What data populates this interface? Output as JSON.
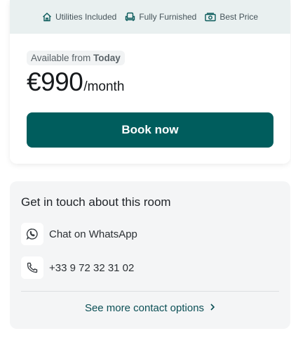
{
  "features": {
    "utilities": "Utilities Included",
    "furnished": "Fully Furnished",
    "price": "Best Price"
  },
  "availability": {
    "prefix": "Available from",
    "date": "Today"
  },
  "pricing": {
    "amount": "€990",
    "period": "/month"
  },
  "booking": {
    "button_label": "Book now"
  },
  "contact": {
    "title": "Get in touch about this room",
    "whatsapp_label": "Chat on WhatsApp",
    "phone_number": "+33 9 72 32 31 02",
    "more_label": "See more contact options"
  },
  "colors": {
    "primary": "#005d5d",
    "feature_bar": "#e9f0f0",
    "contact_bg": "#f4f5f6"
  },
  "icons": {
    "utilities": "house-icon",
    "furnished": "armchair-icon",
    "price": "banknote-icon",
    "whatsapp": "whatsapp-icon",
    "phone": "phone-icon",
    "more": "chevron-right-icon"
  }
}
